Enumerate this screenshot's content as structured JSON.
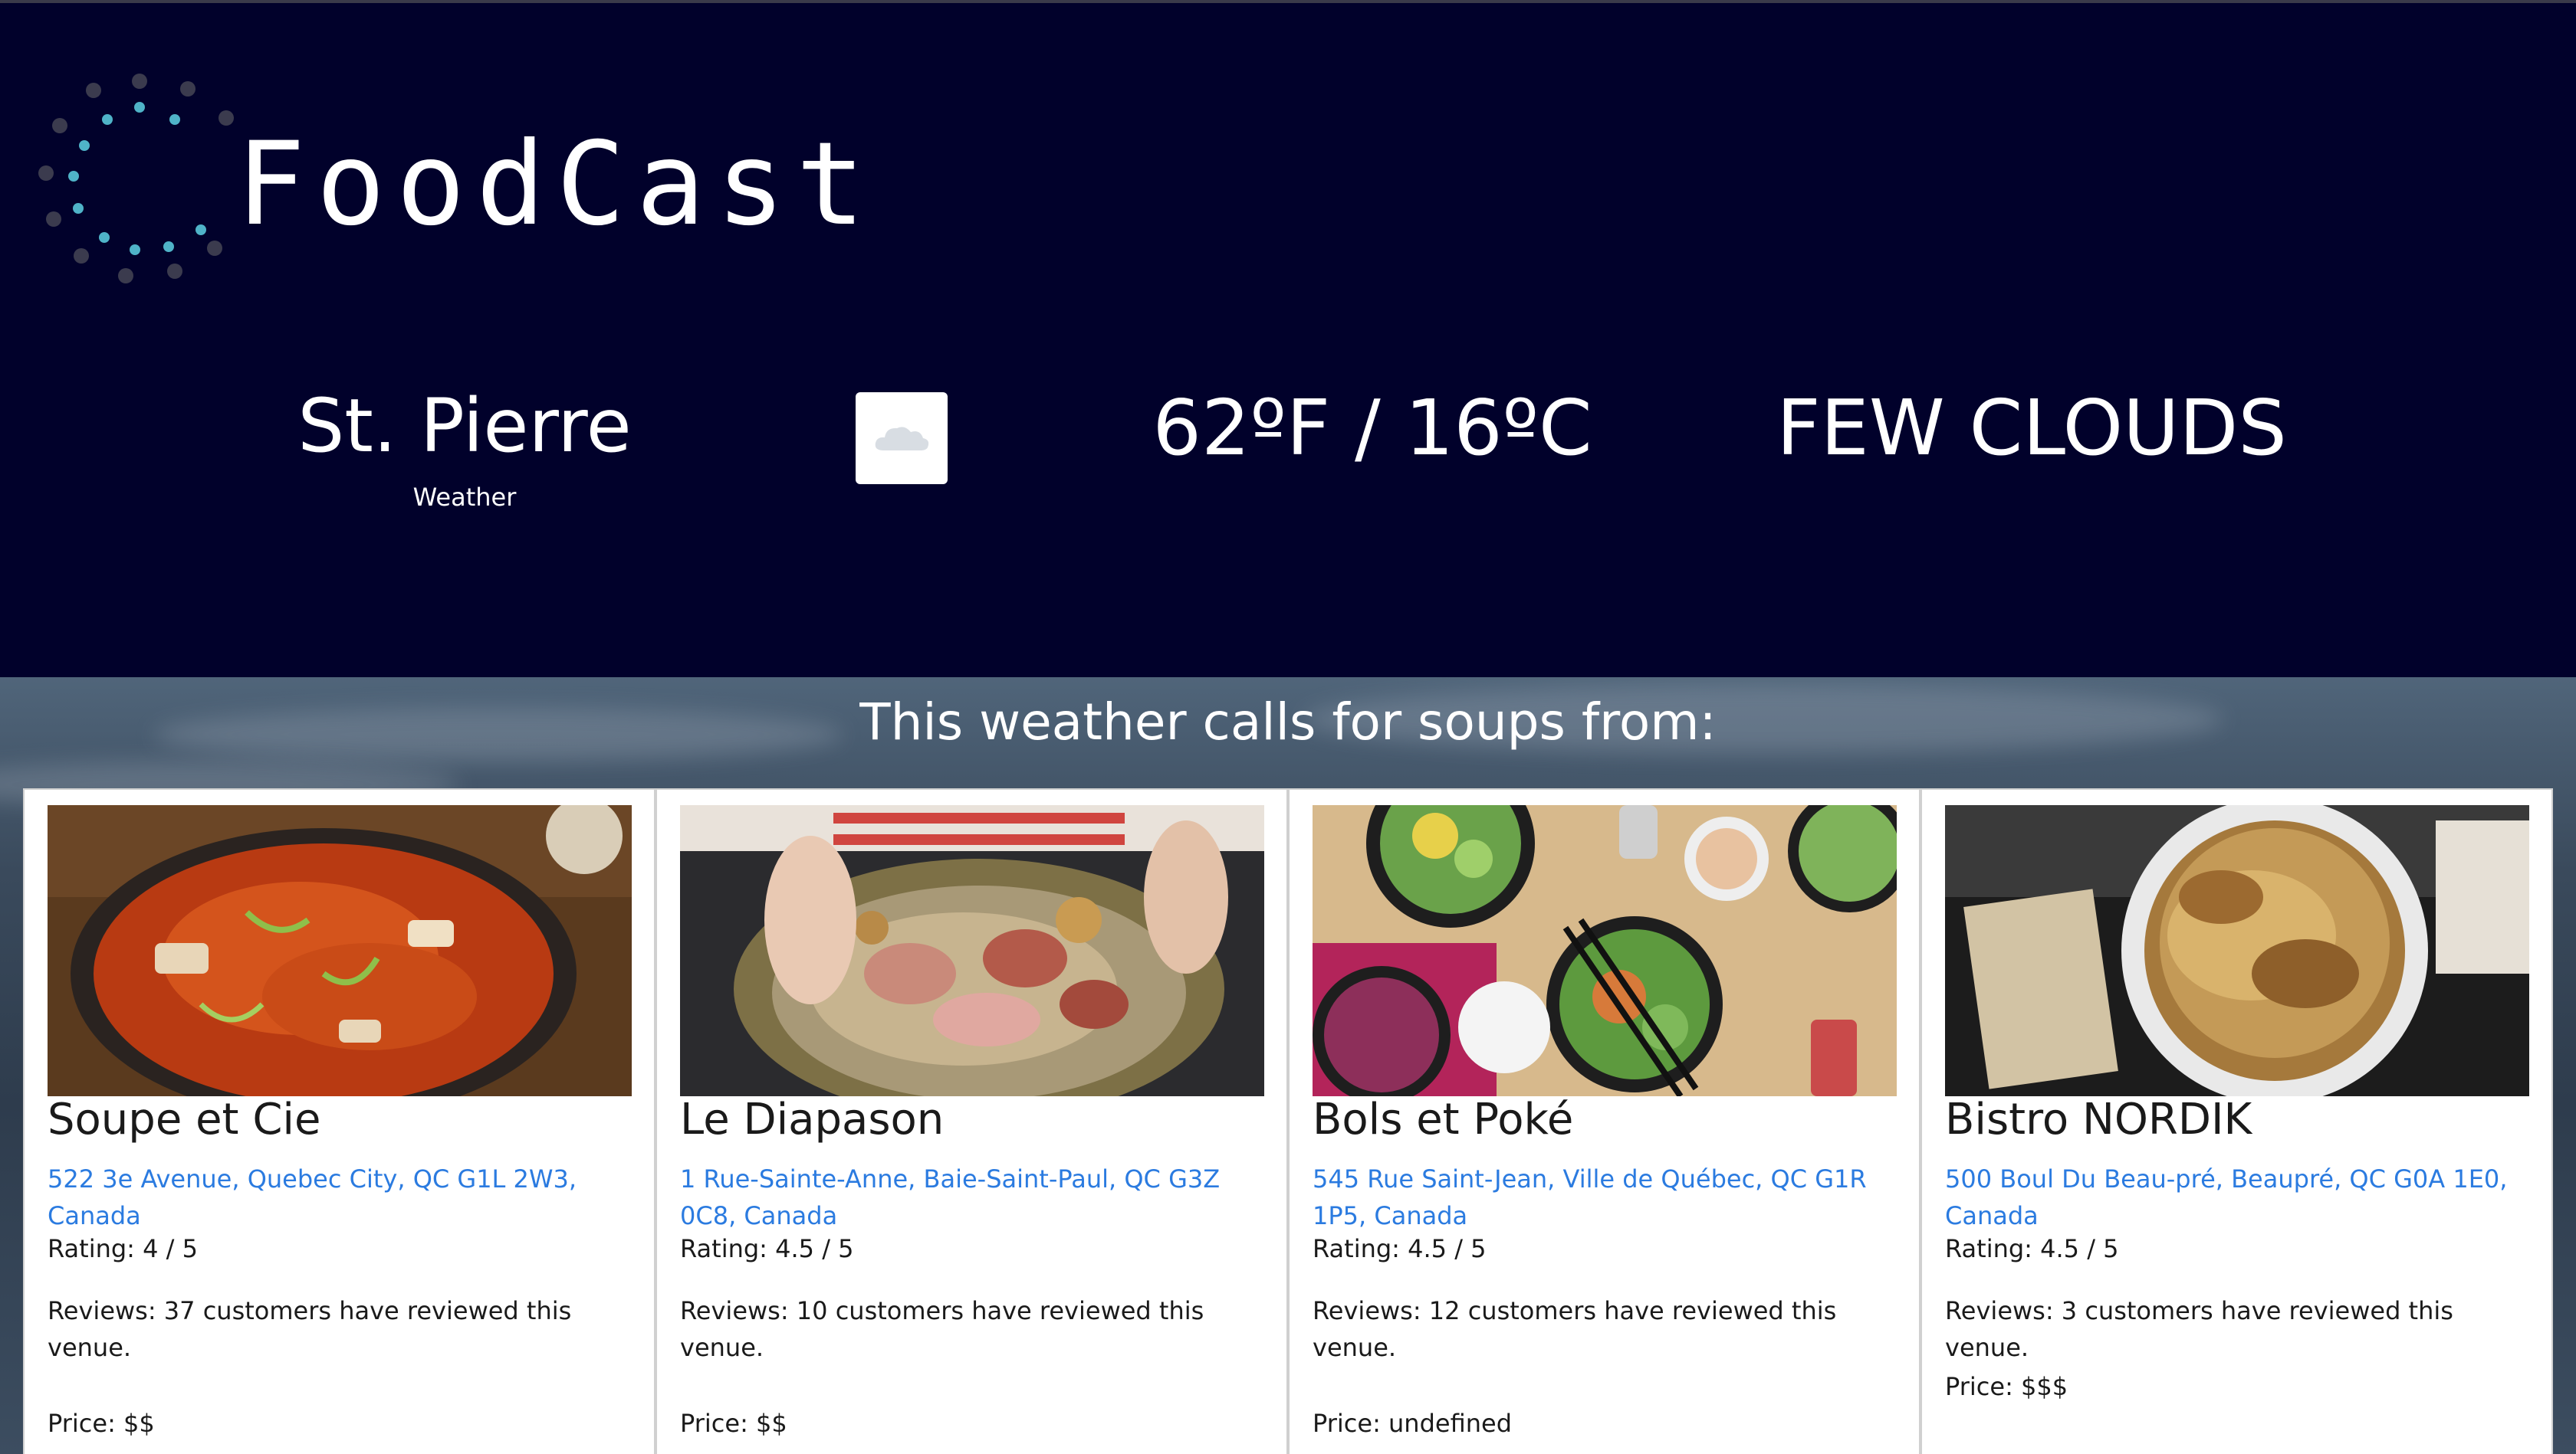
{
  "app": {
    "logo_text": "FoodCast",
    "colors": {
      "header_bg": "#01012b",
      "logo_dot_dark": "#3b3b4e",
      "logo_dot_teal": "#4fb3c8",
      "link": "#2b7be0"
    }
  },
  "weather": {
    "city": "St. Pierre",
    "city_label": "Weather",
    "icon": "cloud-icon",
    "temperature": "62ºF / 16ºC",
    "condition": "FEW CLOUDS"
  },
  "recommendations": {
    "heading": "This weather calls for soups from:",
    "cards": [
      {
        "name": "Soupe et Cie",
        "address": "522 3e Avenue, Quebec City, QC G1L 2W3, Canada",
        "rating": "Rating: 4 / 5",
        "reviews": "Reviews: 37 customers have reviewed this venue.",
        "price": "Price: $$",
        "image": "red-soup-bowl-photo"
      },
      {
        "name": "Le Diapason",
        "address": "1 Rue-Sainte-Anne, Baie-Saint-Paul, QC G3Z 0C8, Canada",
        "rating": "Rating: 4.5 / 5",
        "reviews": "Reviews: 10 customers have reviewed this venue.",
        "price": "Price: $$",
        "image": "sauerkraut-platter-photo"
      },
      {
        "name": "Bols et Poké",
        "address": "545 Rue Saint-Jean, Ville de Québec, QC G1R 1P5, Canada",
        "rating": "Rating: 4.5 / 5",
        "reviews": "Reviews: 12 customers have reviewed this venue.",
        "price": "Price: undefined",
        "image": "poke-bowls-photo"
      },
      {
        "name": "Bistro NORDIK",
        "address": "500 Boul Du Beau-pré, Beaupré, QC G0A 1E0, Canada",
        "rating": "Rating: 4.5 / 5",
        "reviews": "Reviews: 3 customers have reviewed this venue.",
        "price": "Price: $$$",
        "image": "onion-soup-gratin-photo"
      }
    ]
  }
}
